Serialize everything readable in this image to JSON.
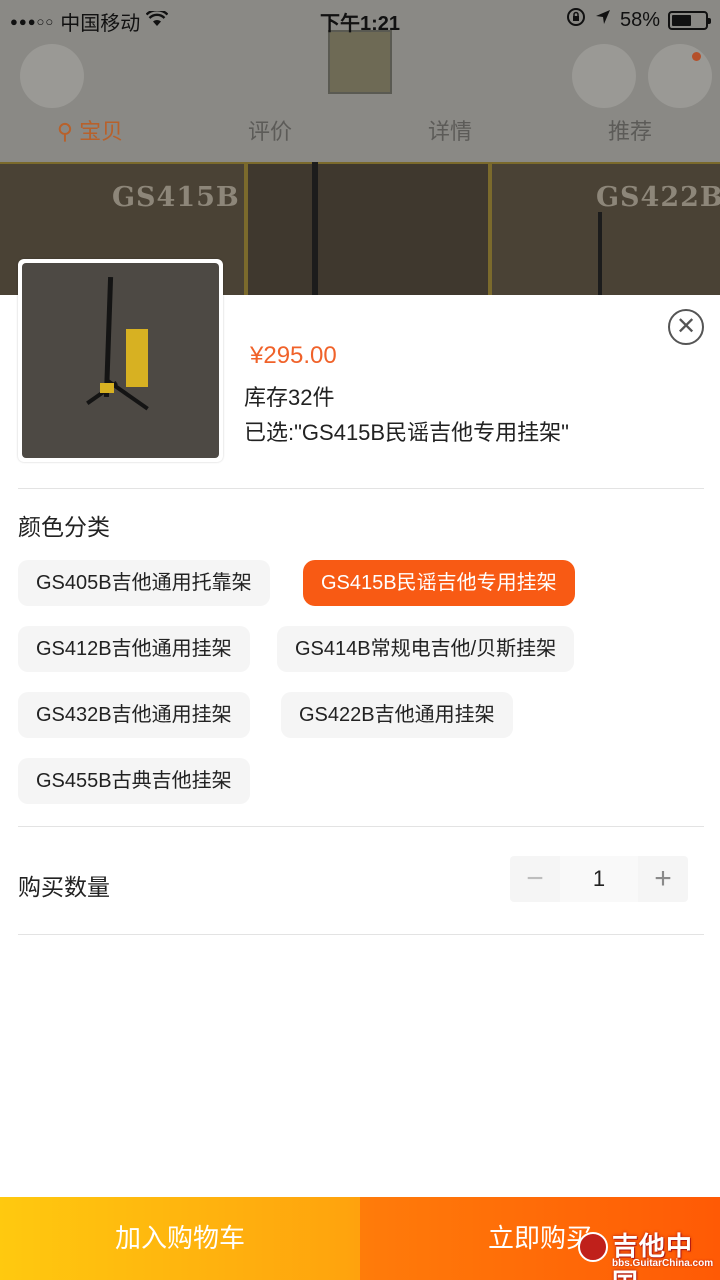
{
  "status_bar": {
    "signal_dots": "●●●○○",
    "carrier": "中国移动",
    "time": "下午1:21",
    "battery": "58%",
    "battery_level": 0.58
  },
  "background_page": {
    "tabs": [
      {
        "label": "宝贝"
      },
      {
        "label": "评价"
      },
      {
        "label": "详情"
      },
      {
        "label": "推荐"
      }
    ],
    "banner_labels": [
      "GS415B",
      "GS422B"
    ]
  },
  "sku_sheet": {
    "price": "¥295.00",
    "stock": "库存32件",
    "selected": "已选:\"GS415B民谣吉他专用挂架\"",
    "color_section_title": "颜色分类",
    "options": [
      {
        "label": "GS405B吉他通用托靠架",
        "selected": false
      },
      {
        "label": "GS415B民谣吉他专用挂架",
        "selected": true
      },
      {
        "label": "GS412B吉他通用挂架",
        "selected": false
      },
      {
        "label": "GS414B常规电吉他/贝斯挂架",
        "selected": false
      },
      {
        "label": "GS432B吉他通用挂架",
        "selected": false
      },
      {
        "label": "GS422B吉他通用挂架",
        "selected": false
      },
      {
        "label": "GS455B古典吉他挂架",
        "selected": false
      }
    ],
    "quantity_label": "购买数量",
    "quantity": "1",
    "minus": "−",
    "plus": "+"
  },
  "actions": {
    "add_to_cart": "加入购物车",
    "buy_now": "立即购买"
  },
  "watermark": {
    "text": "吉他中国",
    "url": "bbs.GuitarChina.com"
  },
  "colors": {
    "accent": "#f85a14",
    "price": "#f0622a",
    "cart_gradient": [
      "#ffc90f",
      "#ffa20d"
    ],
    "buy_gradient": [
      "#ff7c0a",
      "#ff5a05"
    ]
  }
}
